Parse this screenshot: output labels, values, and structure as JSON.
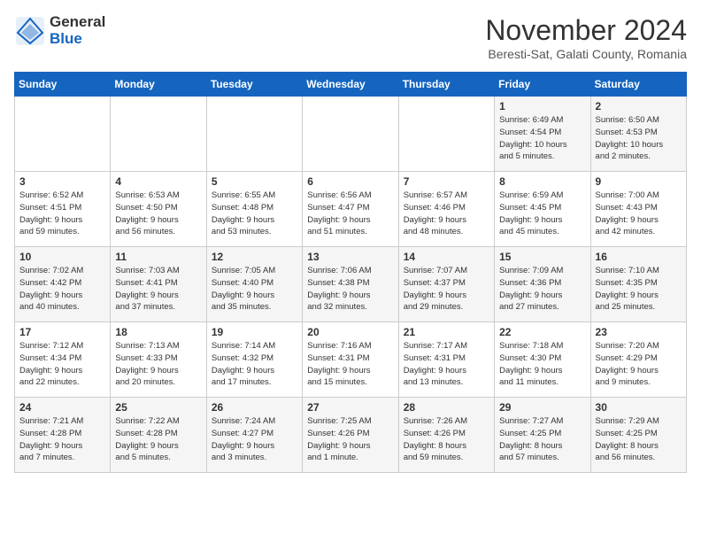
{
  "header": {
    "logo_general": "General",
    "logo_blue": "Blue",
    "month_title": "November 2024",
    "location": "Beresti-Sat, Galati County, Romania"
  },
  "days_of_week": [
    "Sunday",
    "Monday",
    "Tuesday",
    "Wednesday",
    "Thursday",
    "Friday",
    "Saturday"
  ],
  "weeks": [
    [
      {
        "day": "",
        "info": ""
      },
      {
        "day": "",
        "info": ""
      },
      {
        "day": "",
        "info": ""
      },
      {
        "day": "",
        "info": ""
      },
      {
        "day": "",
        "info": ""
      },
      {
        "day": "1",
        "info": "Sunrise: 6:49 AM\nSunset: 4:54 PM\nDaylight: 10 hours\nand 5 minutes."
      },
      {
        "day": "2",
        "info": "Sunrise: 6:50 AM\nSunset: 4:53 PM\nDaylight: 10 hours\nand 2 minutes."
      }
    ],
    [
      {
        "day": "3",
        "info": "Sunrise: 6:52 AM\nSunset: 4:51 PM\nDaylight: 9 hours\nand 59 minutes."
      },
      {
        "day": "4",
        "info": "Sunrise: 6:53 AM\nSunset: 4:50 PM\nDaylight: 9 hours\nand 56 minutes."
      },
      {
        "day": "5",
        "info": "Sunrise: 6:55 AM\nSunset: 4:48 PM\nDaylight: 9 hours\nand 53 minutes."
      },
      {
        "day": "6",
        "info": "Sunrise: 6:56 AM\nSunset: 4:47 PM\nDaylight: 9 hours\nand 51 minutes."
      },
      {
        "day": "7",
        "info": "Sunrise: 6:57 AM\nSunset: 4:46 PM\nDaylight: 9 hours\nand 48 minutes."
      },
      {
        "day": "8",
        "info": "Sunrise: 6:59 AM\nSunset: 4:45 PM\nDaylight: 9 hours\nand 45 minutes."
      },
      {
        "day": "9",
        "info": "Sunrise: 7:00 AM\nSunset: 4:43 PM\nDaylight: 9 hours\nand 42 minutes."
      }
    ],
    [
      {
        "day": "10",
        "info": "Sunrise: 7:02 AM\nSunset: 4:42 PM\nDaylight: 9 hours\nand 40 minutes."
      },
      {
        "day": "11",
        "info": "Sunrise: 7:03 AM\nSunset: 4:41 PM\nDaylight: 9 hours\nand 37 minutes."
      },
      {
        "day": "12",
        "info": "Sunrise: 7:05 AM\nSunset: 4:40 PM\nDaylight: 9 hours\nand 35 minutes."
      },
      {
        "day": "13",
        "info": "Sunrise: 7:06 AM\nSunset: 4:38 PM\nDaylight: 9 hours\nand 32 minutes."
      },
      {
        "day": "14",
        "info": "Sunrise: 7:07 AM\nSunset: 4:37 PM\nDaylight: 9 hours\nand 29 minutes."
      },
      {
        "day": "15",
        "info": "Sunrise: 7:09 AM\nSunset: 4:36 PM\nDaylight: 9 hours\nand 27 minutes."
      },
      {
        "day": "16",
        "info": "Sunrise: 7:10 AM\nSunset: 4:35 PM\nDaylight: 9 hours\nand 25 minutes."
      }
    ],
    [
      {
        "day": "17",
        "info": "Sunrise: 7:12 AM\nSunset: 4:34 PM\nDaylight: 9 hours\nand 22 minutes."
      },
      {
        "day": "18",
        "info": "Sunrise: 7:13 AM\nSunset: 4:33 PM\nDaylight: 9 hours\nand 20 minutes."
      },
      {
        "day": "19",
        "info": "Sunrise: 7:14 AM\nSunset: 4:32 PM\nDaylight: 9 hours\nand 17 minutes."
      },
      {
        "day": "20",
        "info": "Sunrise: 7:16 AM\nSunset: 4:31 PM\nDaylight: 9 hours\nand 15 minutes."
      },
      {
        "day": "21",
        "info": "Sunrise: 7:17 AM\nSunset: 4:31 PM\nDaylight: 9 hours\nand 13 minutes."
      },
      {
        "day": "22",
        "info": "Sunrise: 7:18 AM\nSunset: 4:30 PM\nDaylight: 9 hours\nand 11 minutes."
      },
      {
        "day": "23",
        "info": "Sunrise: 7:20 AM\nSunset: 4:29 PM\nDaylight: 9 hours\nand 9 minutes."
      }
    ],
    [
      {
        "day": "24",
        "info": "Sunrise: 7:21 AM\nSunset: 4:28 PM\nDaylight: 9 hours\nand 7 minutes."
      },
      {
        "day": "25",
        "info": "Sunrise: 7:22 AM\nSunset: 4:28 PM\nDaylight: 9 hours\nand 5 minutes."
      },
      {
        "day": "26",
        "info": "Sunrise: 7:24 AM\nSunset: 4:27 PM\nDaylight: 9 hours\nand 3 minutes."
      },
      {
        "day": "27",
        "info": "Sunrise: 7:25 AM\nSunset: 4:26 PM\nDaylight: 9 hours\nand 1 minute."
      },
      {
        "day": "28",
        "info": "Sunrise: 7:26 AM\nSunset: 4:26 PM\nDaylight: 8 hours\nand 59 minutes."
      },
      {
        "day": "29",
        "info": "Sunrise: 7:27 AM\nSunset: 4:25 PM\nDaylight: 8 hours\nand 57 minutes."
      },
      {
        "day": "30",
        "info": "Sunrise: 7:29 AM\nSunset: 4:25 PM\nDaylight: 8 hours\nand 56 minutes."
      }
    ]
  ]
}
